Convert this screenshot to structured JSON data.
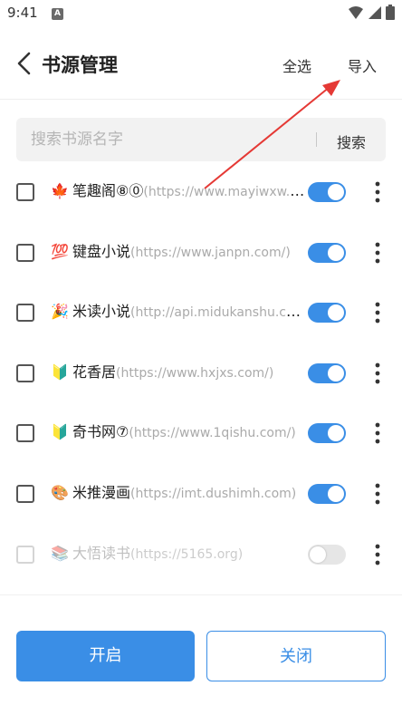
{
  "status_bar": {
    "time": "9:41",
    "notification_badge": "A",
    "icons": [
      "wifi-icon",
      "signal-icon",
      "battery-icon"
    ]
  },
  "header": {
    "title": "书源管理",
    "select_all_label": "全选",
    "import_label": "导入",
    "back_icon": "chevron-left-icon"
  },
  "search": {
    "placeholder": "搜索书源名字",
    "value": "",
    "button_label": "搜索"
  },
  "sources": [
    {
      "emoji": "🍁",
      "name": "笔趣阁⑧⓪",
      "url": "(https://www.mayiwxw.com/)",
      "enabled": true,
      "checked": false
    },
    {
      "emoji": "💯",
      "name": "键盘小说",
      "url": "(https://www.janpn.com/)",
      "enabled": true,
      "checked": false
    },
    {
      "emoji": "🎉",
      "name": "米读小说",
      "url": "(http://api.midukanshu.com/)",
      "enabled": true,
      "checked": false
    },
    {
      "emoji": "🔰",
      "name": "花香居",
      "url": "(https://www.hxjxs.com/)",
      "enabled": true,
      "checked": false
    },
    {
      "emoji": "🔰",
      "name": "奇书网⑦",
      "url": "(https://www.1qishu.com/)",
      "enabled": true,
      "checked": false
    },
    {
      "emoji": "🎨",
      "name": "米推漫画",
      "url": "(https://imt.dushimh.com)",
      "enabled": true,
      "checked": false
    },
    {
      "emoji": "📚",
      "name": "大悟读书",
      "url": "(https://5165.org)",
      "enabled": false,
      "checked": false
    }
  ],
  "footer": {
    "enable_label": "开启",
    "close_label": "关闭"
  },
  "colors": {
    "accent": "#3a8ee6",
    "annotation_arrow": "#e53935",
    "toggle_off": "#e6e6e6"
  }
}
